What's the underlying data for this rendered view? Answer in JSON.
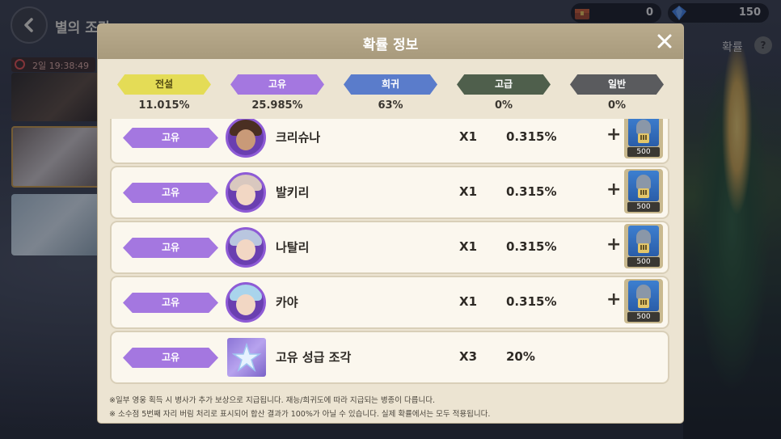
{
  "background": {
    "title": "별의 조각",
    "timer": "2일 19:38:49",
    "currency": [
      {
        "icon": "chest-icon",
        "value": "0"
      },
      {
        "icon": "gem-icon",
        "value": "150"
      }
    ],
    "help_label": "확률"
  },
  "modal": {
    "title": "확률 정보",
    "rarities": [
      {
        "label": "전설",
        "percent": "11.015%"
      },
      {
        "label": "고유",
        "percent": "25.985%"
      },
      {
        "label": "희귀",
        "percent": "63%"
      },
      {
        "label": "고급",
        "percent": "0%"
      },
      {
        "label": "일반",
        "percent": "0%"
      }
    ],
    "rows": [
      {
        "rarity": "고유",
        "name": "크리슈나",
        "qty": "X1",
        "prob": "0.315%",
        "bonus_amount": "500",
        "bonus_icon": "knight-soldier-icon",
        "bonus_grade": "III"
      },
      {
        "rarity": "고유",
        "name": "발키리",
        "qty": "X1",
        "prob": "0.315%",
        "bonus_amount": "500",
        "bonus_icon": "knight-soldier-icon",
        "bonus_grade": "III"
      },
      {
        "rarity": "고유",
        "name": "나탈리",
        "qty": "X1",
        "prob": "0.315%",
        "bonus_amount": "500",
        "bonus_icon": "knight-soldier-icon",
        "bonus_grade": "III"
      },
      {
        "rarity": "고유",
        "name": "카야",
        "qty": "X1",
        "prob": "0.315%",
        "bonus_amount": "500",
        "bonus_icon": "knight-soldier-icon",
        "bonus_grade": "III"
      },
      {
        "rarity": "고유",
        "name": "고유 성급 조각",
        "qty": "X3",
        "prob": "20%"
      }
    ],
    "notes": [
      "※일부 영웅 획득 시 병사가 추가 보상으로 지급됩니다. 재능/희귀도에 따라 지급되는 병종이 다릅니다.",
      "※ 소수점 5번째 자리 버림 처리로 표시되어 합산 결과가 100%가 아닐 수 있습니다. 실제 확률에서는 모두 적용됩니다."
    ]
  }
}
